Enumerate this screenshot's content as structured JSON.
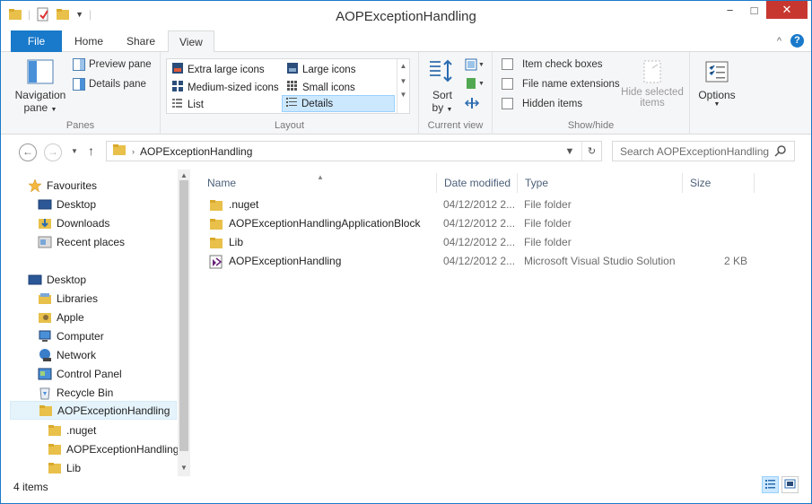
{
  "window": {
    "title": "AOPExceptionHandling",
    "minimize_label": "−",
    "maximize_label": "□",
    "close_label": "✕"
  },
  "ribbon_tabs": {
    "file": "File",
    "home": "Home",
    "share": "Share",
    "view": "View",
    "collapse_label": "^",
    "help_label": "?"
  },
  "ribbon": {
    "panes": {
      "navigation_pane_line1": "Navigation",
      "navigation_pane_line2": "pane",
      "preview_pane": "Preview pane",
      "details_pane": "Details pane",
      "label": "Panes"
    },
    "layout": {
      "extra_large_icons": "Extra large icons",
      "large_icons": "Large icons",
      "medium_icons": "Medium-sized icons",
      "small_icons": "Small icons",
      "list": "List",
      "details": "Details",
      "label": "Layout"
    },
    "current_view": {
      "sort_by_line1": "Sort",
      "sort_by_line2": "by",
      "label": "Current view"
    },
    "show_hide": {
      "item_check_boxes": "Item check boxes",
      "file_name_extensions": "File name extensions",
      "hidden_items": "Hidden items",
      "hide_selected_line1": "Hide selected",
      "hide_selected_line2": "items",
      "label": "Show/hide"
    },
    "options": {
      "label": "Options"
    }
  },
  "address": {
    "path": "AOPExceptionHandling",
    "search_placeholder": "Search AOPExceptionHandling"
  },
  "nav_pane": {
    "favourites": "Favourites",
    "desktop_fav": "Desktop",
    "downloads": "Downloads",
    "recent_places": "Recent places",
    "desktop": "Desktop",
    "libraries": "Libraries",
    "apple": "Apple",
    "computer": "Computer",
    "network": "Network",
    "control_panel": "Control Panel",
    "recycle_bin": "Recycle Bin",
    "aop_folder": "AOPExceptionHandling",
    "nuget": ".nuget",
    "aop_sub": "AOPExceptionHandling",
    "lib": "Lib"
  },
  "columns": {
    "name": "Name",
    "date_modified": "Date modified",
    "type": "Type",
    "size": "Size"
  },
  "files": [
    {
      "name": ".nuget",
      "date": "04/12/2012 2...",
      "type": "File folder",
      "size": ""
    },
    {
      "name": "AOPExceptionHandlingApplicationBlock",
      "date": "04/12/2012 2...",
      "type": "File folder",
      "size": ""
    },
    {
      "name": "Lib",
      "date": "04/12/2012 2...",
      "type": "File folder",
      "size": ""
    },
    {
      "name": "AOPExceptionHandling",
      "date": "04/12/2012 2...",
      "type": "Microsoft Visual Studio Solution",
      "size": "2 KB"
    }
  ],
  "status": {
    "count": "4 items"
  },
  "icons": {
    "folder": "folder-icon",
    "solution": "visual-studio-solution-icon",
    "star": "star-icon",
    "search": "search-icon",
    "refresh": "refresh-icon",
    "back": "back-arrow-icon",
    "forward": "forward-arrow-icon",
    "up": "up-arrow-icon"
  },
  "colors": {
    "accent": "#1979ca",
    "close_red": "#c7372f",
    "folder_yellow": "#e8c04a",
    "selection": "#cce8ff"
  }
}
